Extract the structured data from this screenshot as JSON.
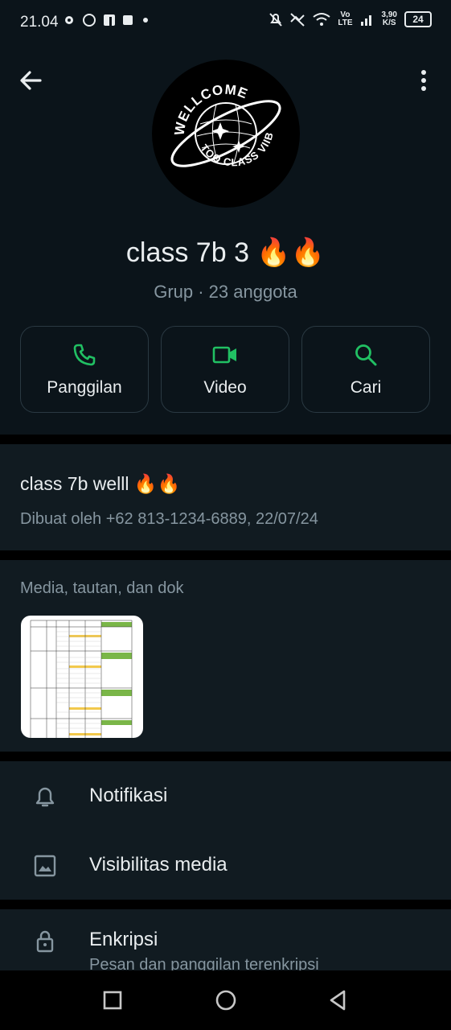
{
  "status_bar": {
    "time": "21.04",
    "speed_top": "3,90",
    "speed_bottom": "K/S",
    "network_label_top": "Vo",
    "network_label_bottom": "LTE",
    "battery": "24"
  },
  "profile": {
    "avatar_ring_text": "WELLCOME",
    "avatar_bottom_text": "TOO CLASS VIIB",
    "name": "class 7b 3 🔥🔥",
    "meta": "Grup · 23 anggota"
  },
  "actions": [
    {
      "label": "Panggilan",
      "icon": "phone-icon"
    },
    {
      "label": "Video",
      "icon": "video-icon"
    },
    {
      "label": "Cari",
      "icon": "search-icon"
    }
  ],
  "description": {
    "title": "class 7b welll 🔥🔥",
    "created": "Dibuat oleh +62 813-1234-6889, 22/07/24"
  },
  "media": {
    "title": "Media, tautan, dan dok"
  },
  "settings": {
    "notifications": "Notifikasi",
    "media_visibility": "Visibilitas media",
    "encryption_title": "Enkripsi",
    "encryption_sub": "Pesan dan panggilan terenkripsi"
  },
  "colors": {
    "accent_green": "#21c063",
    "background": "#0b141a",
    "panel": "#111b21",
    "secondary_text": "#8696a0"
  }
}
